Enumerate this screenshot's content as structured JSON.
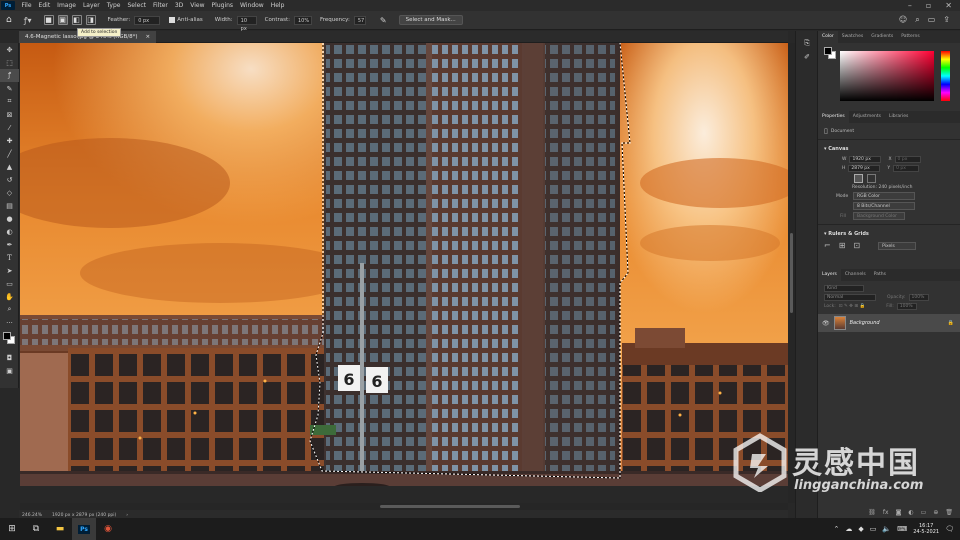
{
  "app": {
    "logo": "Ps",
    "menu": [
      "File",
      "Edit",
      "Image",
      "Layer",
      "Type",
      "Select",
      "Filter",
      "3D",
      "View",
      "Plugins",
      "Window",
      "Help"
    ]
  },
  "options": {
    "feather_label": "Feather:",
    "feather_value": "0 px",
    "antialias_label": "Anti-alias",
    "width_label": "Width:",
    "width_value": "10 px",
    "contrast_label": "Contrast:",
    "contrast_value": "10%",
    "frequency_label": "Frequency:",
    "frequency_value": "57",
    "select_mask_label": "Select and Mask...",
    "tooltip": "Add to selection"
  },
  "document": {
    "tab_title": "4.6-Magnetic lasso.jpg @ 246% (RGB/8*)",
    "tab_close": "×",
    "zoom": "246.24%",
    "info": "1920 px x 2879 px (240 ppi)"
  },
  "color_panel": {
    "tabs": [
      "Color",
      "Swatches",
      "Gradients",
      "Patterns"
    ],
    "accent": "#ff0033"
  },
  "properties_panel": {
    "tabs": [
      "Properties",
      "Adjustments",
      "Libraries"
    ],
    "doc_label": "Document",
    "canvas_header": "Canvas",
    "w_label": "W",
    "w_value": "1920 px",
    "x_label": "X",
    "x_value": "0 px",
    "h_label": "H",
    "h_value": "2879 px",
    "y_label": "Y",
    "y_value": "0 px",
    "resolution": "Resolution: 240 pixels/inch",
    "mode_label": "Mode",
    "mode_value": "RGB Color",
    "bits_value": "8 Bits/Channel",
    "fill_label": "Fill",
    "fill_value": "Background Color",
    "rulers_header": "Rulers & Grids",
    "units_value": "Pixels"
  },
  "layers_panel": {
    "tabs": [
      "Layers",
      "Channels",
      "Paths"
    ],
    "kind_placeholder": "Kind",
    "blend_mode": "Normal",
    "opacity_label": "Opacity:",
    "opacity_value": "100%",
    "lock_label": "Lock:",
    "fill_label": "Fill:",
    "fill_value": "100%",
    "layer_name": "Background"
  },
  "taskbar": {
    "time": "16:17",
    "date": "24-5-2021"
  },
  "watermark": {
    "cn": "灵感中国",
    "en": "lingganchina.com"
  }
}
